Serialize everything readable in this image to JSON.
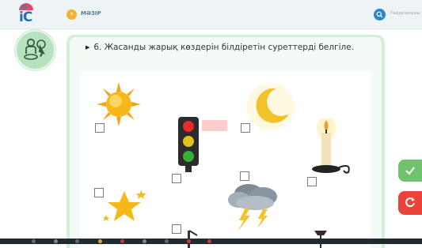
{
  "header": {
    "logo_small": "ОЙ",
    "logo_main": "iC",
    "breadcrumb": "МӘЗІР",
    "user_label": "Пайдаланушы",
    "search_icon": "search-icon",
    "menu_icon": "chevron-right-icon"
  },
  "task": {
    "number_text": "6. Жасанды жарық көздерін білдіретін суреттерді белгіле."
  },
  "items": [
    {
      "name": "sun",
      "checked": false
    },
    {
      "name": "traffic-light",
      "checked": false
    },
    {
      "name": "moon",
      "checked": false
    },
    {
      "name": "candle",
      "checked": false
    },
    {
      "name": "star",
      "checked": false
    },
    {
      "name": "lightning",
      "checked": false
    },
    {
      "name": "desk-lamp",
      "checked": false
    },
    {
      "name": "lamp",
      "checked": false
    }
  ],
  "actions": {
    "check_icon": "checkmark-icon",
    "reset_icon": "refresh-icon"
  },
  "colors": {
    "check": "#71c26c",
    "reset": "#eb4339",
    "panel": "#d6efd8",
    "accent": "#2b86c8"
  }
}
